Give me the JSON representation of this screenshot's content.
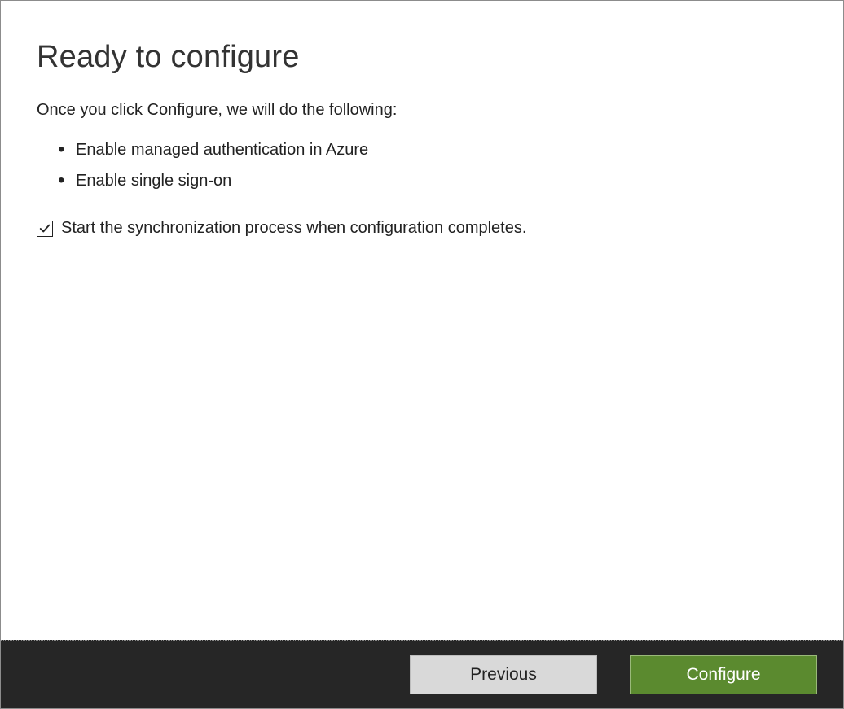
{
  "header": {
    "title": "Ready to configure"
  },
  "intro": "Once you click Configure, we will do the following:",
  "bullets": [
    "Enable managed authentication in Azure",
    "Enable single sign-on"
  ],
  "checkbox": {
    "checked": true,
    "label": "Start the synchronization process when configuration completes."
  },
  "footer": {
    "previous_label": "Previous",
    "configure_label": "Configure"
  }
}
